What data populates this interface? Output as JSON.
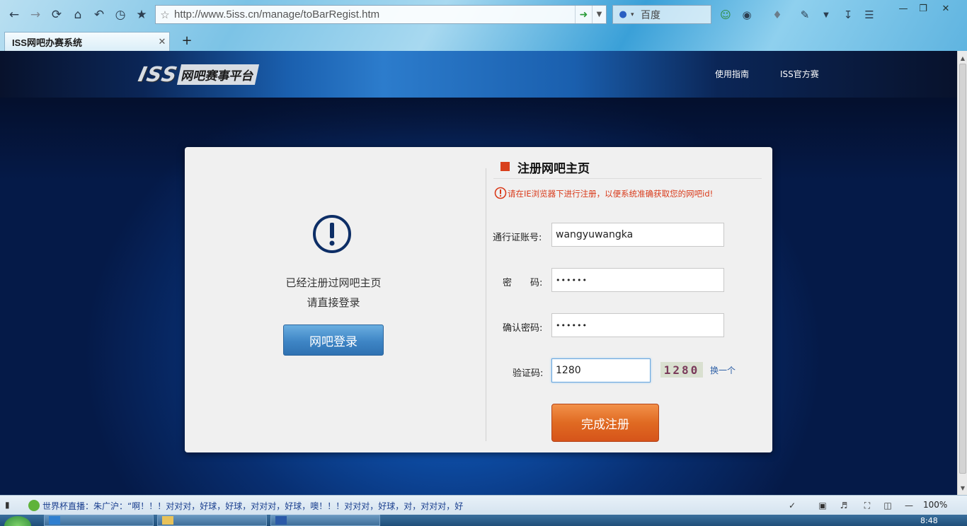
{
  "browser": {
    "url": "http://www.5iss.cn/manage/toBarRegist.htm",
    "search_engine": "百度",
    "tab_title": "ISS网吧办赛系统",
    "new_tab_symbol": "+"
  },
  "site": {
    "logo_iss": "ISS",
    "logo_platform": "网吧赛事平台",
    "nav": [
      "使用指南",
      "ISS官方赛"
    ]
  },
  "left_panel": {
    "message_line1": "已经注册过网吧主页",
    "message_line2": "请直接登录",
    "login_button": "网吧登录"
  },
  "form": {
    "title": "注册网吧主页",
    "warning": "请在IE浏览器下进行注册，以便系统准确获取您的网吧id!",
    "account_label": "通行证账号:",
    "account_value": "wangyuwangka",
    "password_label": "密　　码:",
    "password_value": "••••••",
    "confirm_label": "确认密码:",
    "confirm_value": "••••••",
    "captcha_label": "验证码:",
    "captcha_value": "1280",
    "captcha_image_text": "1280",
    "captcha_refresh": "换一个",
    "submit_button": "完成注册"
  },
  "statusbar": {
    "news": "世界杯直播：朱广沪：“啊！！！对对对，好球，好球，对对对，好球，噢！！！对对对，好球，对，对对对，好",
    "zoom": "100%"
  },
  "taskbar": {
    "clock": "8:48"
  },
  "colors": {
    "accent_red": "#d8401c",
    "submit_orange": "#e06a22",
    "login_blue": "#3e85c5",
    "warning_red": "#d93a1a"
  }
}
